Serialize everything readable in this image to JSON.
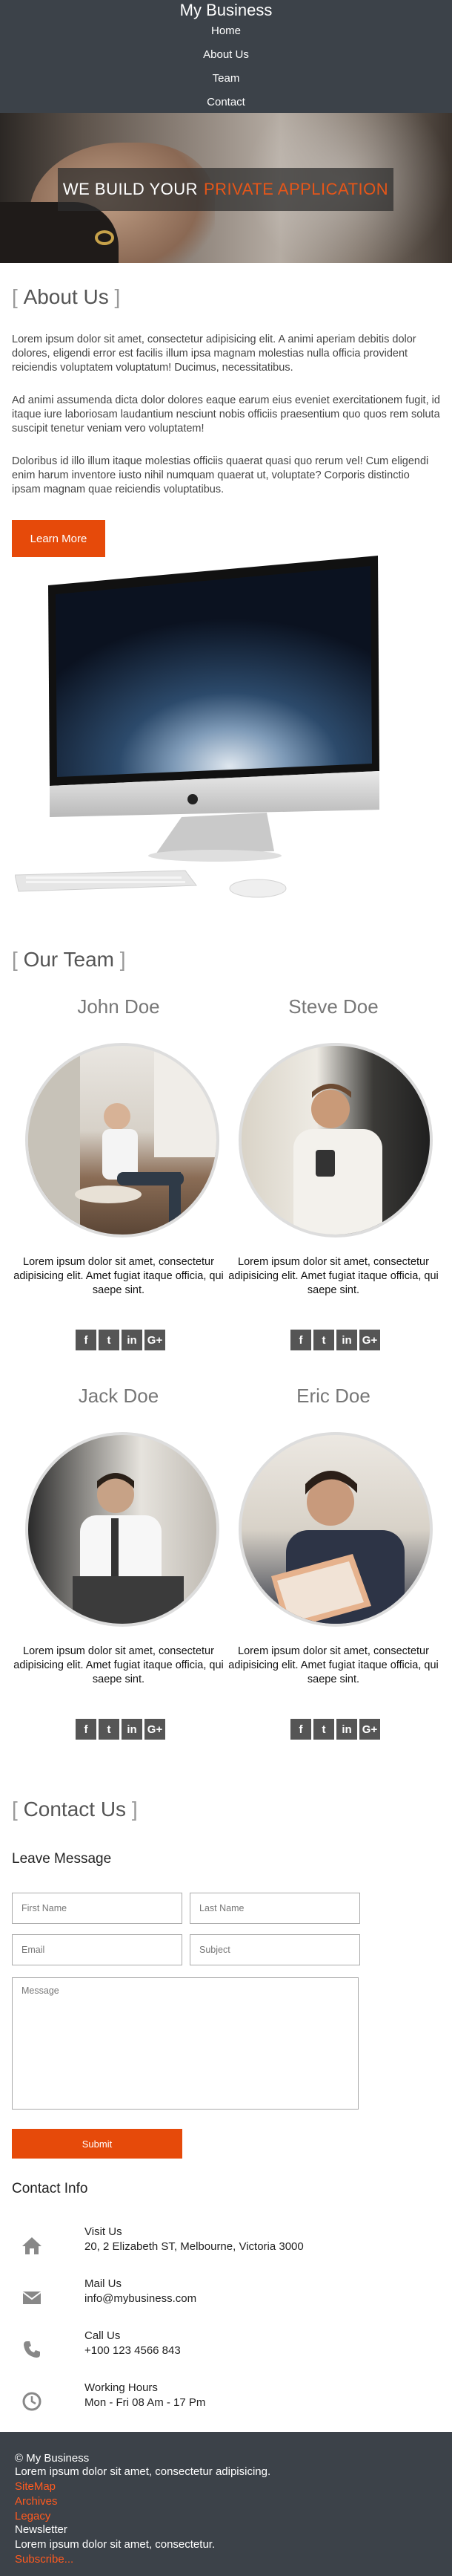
{
  "nav": {
    "brand": "My Business",
    "items": [
      {
        "label": "Home"
      },
      {
        "label": "About Us"
      },
      {
        "label": "Team"
      },
      {
        "label": "Contact"
      }
    ]
  },
  "hero": {
    "text_white": "WE BUILD YOUR",
    "text_orange": "PRIVATE APPLICATION",
    "accent_color": "#e55619"
  },
  "about": {
    "title": "About Us",
    "paragraphs": [
      "Lorem ipsum dolor sit amet, consectetur adipisicing elit. A animi aperiam debitis dolor dolores, eligendi error est facilis illum ipsa magnam molestias nulla officia provident reiciendis voluptatem voluptatum! Ducimus, necessitatibus.",
      "Ad animi assumenda dicta dolor dolores eaque earum eius eveniet exercitationem fugit, id itaque iure laboriosam laudantium nesciunt nobis officiis praesentium quo quos rem soluta suscipit tenetur veniam vero voluptatem!",
      "Doloribus id illo illum itaque molestias officiis quaerat quasi quo rerum vel! Cum eligendi enim harum inventore iusto nihil numquam quaerat ut, voluptate? Corporis distinctio ipsam magnam quae reiciendis voluptatibus."
    ],
    "button_label": "Learn More"
  },
  "team": {
    "title": "Our Team",
    "members": [
      {
        "name": "John Doe",
        "bio": "Lorem ipsum dolor sit amet, consectetur adipisicing elit. Amet fugiat itaque officia, qui saepe sint."
      },
      {
        "name": "Steve Doe",
        "bio": "Lorem ipsum dolor sit amet, consectetur adipisicing elit. Amet fugiat itaque officia, qui saepe sint."
      },
      {
        "name": "Jack Doe",
        "bio": "Lorem ipsum dolor sit amet, consectetur adipisicing elit. Amet fugiat itaque officia, qui saepe sint."
      },
      {
        "name": "Eric Doe",
        "bio": "Lorem ipsum dolor sit amet, consectetur adipisicing elit. Amet fugiat itaque officia, qui saepe sint."
      }
    ],
    "social_icons": [
      "facebook-icon",
      "twitter-icon",
      "linkedin-icon",
      "google-plus-icon"
    ]
  },
  "contact": {
    "title": "Contact Us",
    "leave_message": "Leave Message",
    "fields": {
      "first_name": "First Name",
      "last_name": "Last Name",
      "email": "Email",
      "subject": "Subject",
      "message": "Message"
    },
    "submit_label": "Submit",
    "info_title": "Contact Info",
    "info": [
      {
        "icon": "home-icon",
        "title": "Visit Us",
        "value": "20, 2 Elizabeth ST, Melbourne, Victoria 3000"
      },
      {
        "icon": "envelope-icon",
        "title": "Mail Us",
        "value": "info@mybusiness.com"
      },
      {
        "icon": "phone-icon",
        "title": "Call Us",
        "value": "+100 123 4566 843"
      },
      {
        "icon": "clock-icon",
        "title": "Working Hours",
        "value": "Mon - Fri 08 Am - 17 Pm"
      }
    ]
  },
  "footer": {
    "copyright": "© My Business",
    "tagline": "Lorem ipsum dolor sit amet, consectetur adipisicing.",
    "links": [
      "SiteMap",
      "Archives",
      "Legacy"
    ],
    "newsletter_title": "Newsletter",
    "newsletter_text": "Lorem ipsum dolor sit amet, consectetur.",
    "subscribe_label": "Subscribe..."
  },
  "colors": {
    "nav_bg": "#3c4249",
    "accent": "#e64a0a",
    "link": "#ff5a1f"
  }
}
